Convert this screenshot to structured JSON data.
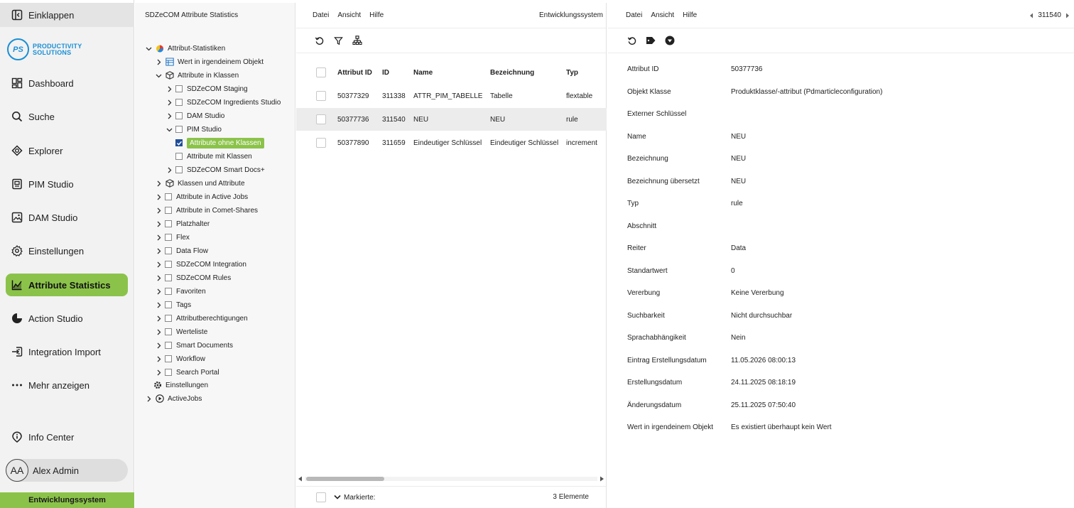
{
  "nav": {
    "collapse": "Einklappen",
    "logo_mark": "PS",
    "logo_line1": "PRODUCTIVITY",
    "logo_line2": "SOLUTIONS",
    "items": [
      {
        "label": "Dashboard",
        "icon": "dashboard-icon"
      },
      {
        "label": "Suche",
        "icon": "search-icon"
      },
      {
        "label": "Explorer",
        "icon": "explorer-icon"
      },
      {
        "label": "PIM Studio",
        "icon": "pim-icon"
      },
      {
        "label": "DAM Studio",
        "icon": "image-icon"
      },
      {
        "label": "Einstellungen",
        "icon": "gear-icon"
      },
      {
        "label": "Attribute Statistics",
        "icon": "chart-icon",
        "active": true
      },
      {
        "label": "Action Studio",
        "icon": "action-icon"
      },
      {
        "label": "Integration Import",
        "icon": "import-icon"
      },
      {
        "label": "Mehr anzeigen",
        "icon": "more-icon"
      }
    ],
    "info_center": "Info Center",
    "user_initials": "AA",
    "user_name": "Alex Admin",
    "env": "Entwicklungssystem",
    "accent": "#8bc34a"
  },
  "tree": {
    "title": "SDZeCOM Attribute Statistics",
    "root": "Attribut-Statistiken",
    "items": [
      "Wert in irgendeinem Objekt",
      "Attribute in Klassen",
      "SDZeCOM Staging",
      "SDZeCOM Ingredients Studio",
      "DAM Studio",
      "PIM Studio",
      "Attribute ohne Klassen",
      "Attribute mit Klassen",
      "SDZeCOM Smart Docs+",
      "Klassen und Attribute",
      "Attribute in Active Jobs",
      "Attribute in Comet-Shares",
      "Platzhalter",
      "Flex",
      "Data Flow",
      "SDZeCOM Integration",
      "SDZeCOM Rules",
      "Favoriten",
      "Tags",
      "Attributberechtigungen",
      "Werteliste",
      "Smart Documents",
      "Workflow",
      "Search Portal",
      "Einstellungen",
      "ActiveJobs"
    ]
  },
  "list": {
    "menu": [
      "Datei",
      "Ansicht",
      "Hilfe"
    ],
    "env": "Entwicklungssystem",
    "columns": [
      "Attribut ID",
      "ID",
      "Name",
      "Bezeichnung",
      "Typ"
    ],
    "rows": [
      [
        "50377329",
        "311338",
        "ATTR_PIM_TABELLE",
        "Tabelle",
        "flextable"
      ],
      [
        "50377736",
        "311540",
        "NEU",
        "NEU",
        "rule"
      ],
      [
        "50377890",
        "311659",
        "Eindeutiger Schlüssel",
        "Eindeutiger Schlüssel",
        "increment"
      ]
    ],
    "footer_marked": "Markierte:",
    "footer_count": "3 Elemente"
  },
  "detail": {
    "menu": [
      "Datei",
      "Ansicht",
      "Hilfe"
    ],
    "pager": "311540",
    "fields": [
      {
        "label": "Attribut ID",
        "value": "50377736"
      },
      {
        "label": "Objekt Klasse",
        "value": "Produktklasse/-attribut (Pdmarticleconfiguration)"
      },
      {
        "label": "Externer Schlüssel",
        "value": ""
      },
      {
        "label": "Name",
        "value": "NEU"
      },
      {
        "label": "Bezeichnung",
        "value": "NEU"
      },
      {
        "label": "Bezeichnung übersetzt",
        "value": "NEU"
      },
      {
        "label": "Typ",
        "value": "rule"
      },
      {
        "label": "Abschnitt",
        "value": ""
      },
      {
        "label": "Reiter",
        "value": "Data"
      },
      {
        "label": "Standartwert",
        "value": "0"
      },
      {
        "label": "Vererbung",
        "value": "Keine Vererbung"
      },
      {
        "label": "Suchbarkeit",
        "value": "Nicht durchsuchbar"
      },
      {
        "label": "Sprachabhängikeit",
        "value": "Nein"
      },
      {
        "label": "Eintrag Erstellungsdatum",
        "value": "11.05.2026 08:00:13"
      },
      {
        "label": "Erstellungsdatum",
        "value": "24.11.2025 08:18:19"
      },
      {
        "label": "Änderungsdatum",
        "value": "25.11.2025 07:50:40"
      },
      {
        "label": "Wert in irgendeinem Objekt",
        "value": "Es existiert überhaupt kein Wert"
      }
    ]
  }
}
